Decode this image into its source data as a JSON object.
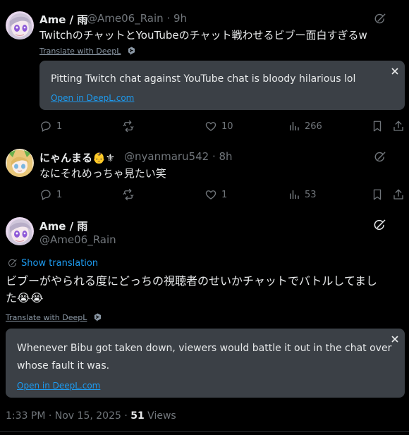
{
  "colors": {
    "background": "#000000",
    "text": "#e7e9ea",
    "muted": "#71767b",
    "link": "#1d9bf0",
    "translation_box": "#3b4046"
  },
  "tweet1": {
    "display_name": "Ame / 雨",
    "meta": "@Ame06_Rain · 9h",
    "text": "TwitchのチャットとYouTubeのチャット戦わせるビブー面白すぎるw",
    "translate_with": "Translate with DeepL",
    "translation": "Pitting Twitch chat against YouTube chat is bloody hilarious lol",
    "open_link": "Open in DeepL.com",
    "replies": "1",
    "likes": "10",
    "views": "266"
  },
  "tweet2": {
    "display_name": "にゃんまる👶⚜",
    "handle": "@nyanmaru542 · 8h",
    "text": "なにそれめっちゃ見たい笑",
    "replies": "1",
    "likes": "1",
    "views": "53"
  },
  "main": {
    "display_name": "Ame / 雨",
    "handle": "@Ame06_Rain",
    "show_translation": "Show translation",
    "text_line1": "ビブーがやられる度にどっちの視聴者のせいかチャットでバトルしてまし",
    "text_line2": "た😭😭",
    "translate_with": "Translate with DeepL",
    "translation": "Whenever Bibu got taken down, viewers would battle it out in the chat over whose fault it was.",
    "open_link": "Open in DeepL.com",
    "timestamp": "1:33 PM · Nov 15, 2025 · ",
    "views_count": "51",
    "views_label": " Views"
  },
  "icons": [
    "grok-icon",
    "reply-icon",
    "repost-icon",
    "like-icon",
    "views-icon",
    "bookmark-icon",
    "share-icon",
    "close-icon",
    "translate-icon",
    "deepl-icon"
  ]
}
